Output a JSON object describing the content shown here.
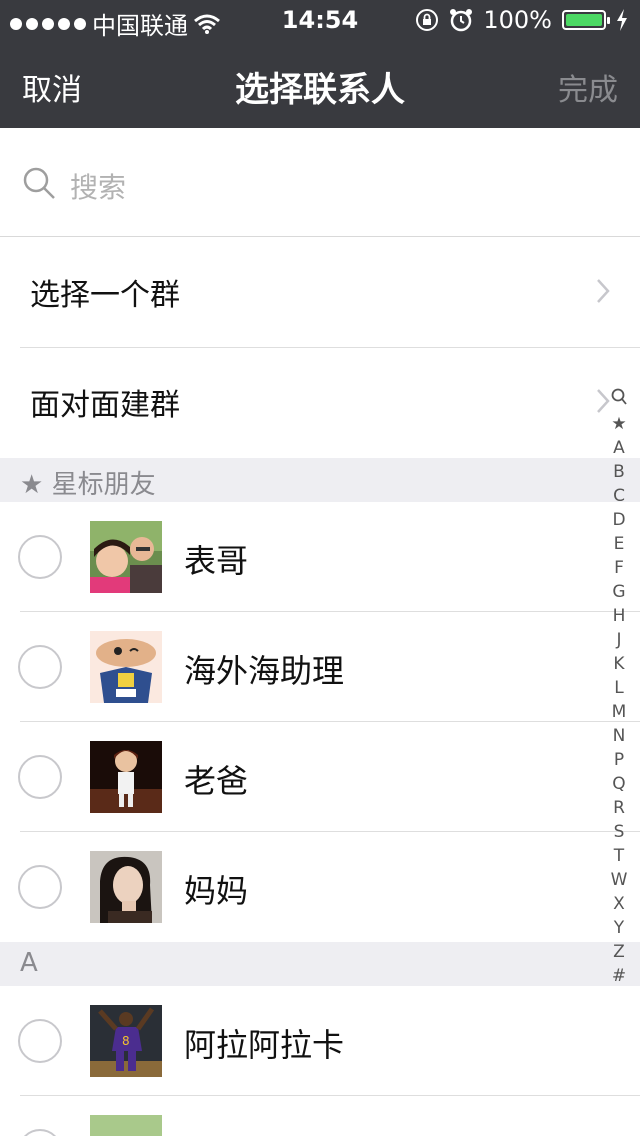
{
  "status_bar": {
    "carrier": "中国联通",
    "time": "14:54",
    "battery": "100%"
  },
  "nav": {
    "cancel": "取消",
    "title": "选择联系人",
    "done": "完成"
  },
  "search": {
    "placeholder": "搜索"
  },
  "options": [
    {
      "label": "选择一个群"
    },
    {
      "label": "面对面建群"
    }
  ],
  "sections": [
    {
      "header": "星标朋友",
      "contacts": [
        "表哥",
        "海外海助理",
        "老爸",
        "妈妈"
      ]
    },
    {
      "header": "A",
      "contacts": [
        "阿拉阿拉卡"
      ]
    }
  ],
  "index_bar": [
    "★",
    "A",
    "B",
    "C",
    "D",
    "E",
    "F",
    "G",
    "H",
    "J",
    "K",
    "L",
    "M",
    "N",
    "P",
    "Q",
    "R",
    "S",
    "T",
    "W",
    "X",
    "Y",
    "Z",
    "#"
  ],
  "colors": {
    "nav_bg": "#393a3f",
    "section_bg": "#eeeef2",
    "battery": "#4cd964"
  }
}
